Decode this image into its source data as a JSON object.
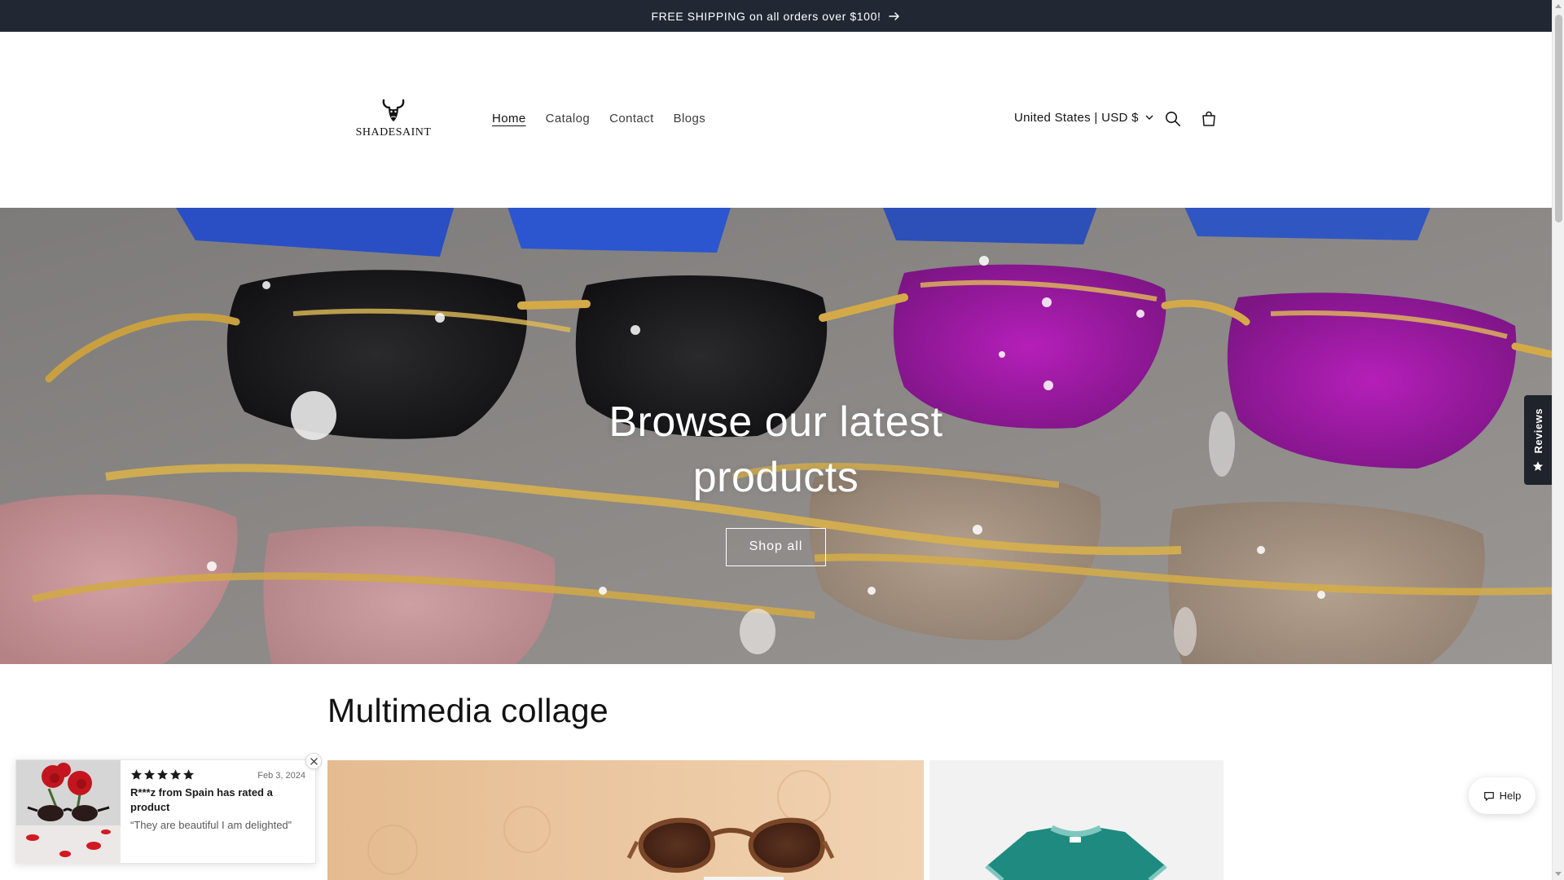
{
  "announcement": {
    "text": "FREE SHIPPING on all orders over $100!",
    "icon": "arrow-right-icon"
  },
  "header": {
    "logo_text": "SHADESAINT",
    "nav": [
      {
        "label": "Home",
        "active": true
      },
      {
        "label": "Catalog",
        "active": false
      },
      {
        "label": "Contact",
        "active": false
      },
      {
        "label": "Blogs",
        "active": false
      }
    ],
    "country_selector": "United States | USD $",
    "icons": [
      "search-icon",
      "cart-icon"
    ]
  },
  "hero": {
    "title": "Browse our latest products",
    "button_label": "Shop all"
  },
  "reviews_tab": {
    "label": "Reviews",
    "icon": "star-icon"
  },
  "collage": {
    "title": "Multimedia collage"
  },
  "review_popup": {
    "rating": 5,
    "date": "Feb 3, 2024",
    "name": "R***z from Spain has rated a product",
    "quote": "“They are beautiful I am delighted”"
  },
  "help": {
    "label": "Help",
    "icon": "chat-icon"
  },
  "colors": {
    "announcement_bg": "#222833",
    "text": "#121212",
    "reviews_tab_bg": "#1e232c",
    "white": "#ffffff"
  }
}
